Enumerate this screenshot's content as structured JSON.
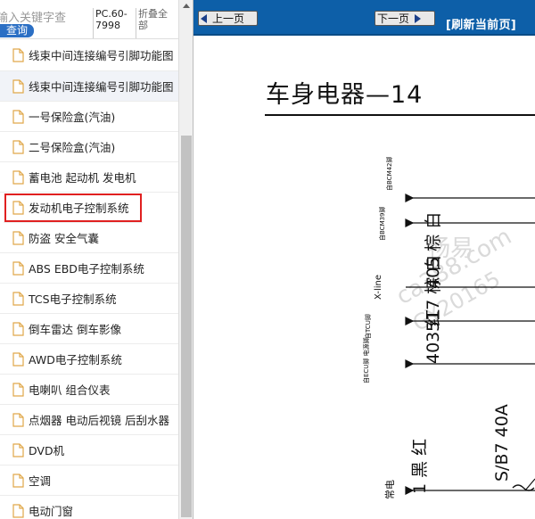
{
  "sidebar": {
    "search": {
      "placeholder": "输入关键字查"
    },
    "search_button": "查询",
    "tab_model": "PC.60-7998",
    "tab_collapse": "折叠全部",
    "items": [
      {
        "label": "线束中间连接编号引脚功能图"
      },
      {
        "label": "线束中间连接编号引脚功能图"
      },
      {
        "label": "一号保险盒(汽油)"
      },
      {
        "label": "二号保险盒(汽油)"
      },
      {
        "label": "蓄电池 起动机 发电机"
      },
      {
        "label": "发动机电子控制系统"
      },
      {
        "label": "防盗 安全气囊"
      },
      {
        "label": "ABS EBD电子控制系统"
      },
      {
        "label": "TCS电子控制系统"
      },
      {
        "label": "倒车雷达 倒车影像"
      },
      {
        "label": "AWD电子控制系统"
      },
      {
        "label": "电喇叭 组合仪表"
      },
      {
        "label": "点烟器 电动后视镜 后刮水器"
      },
      {
        "label": "DVD机"
      },
      {
        "label": "空调"
      },
      {
        "label": "电动门窗"
      }
    ],
    "icon": "document-icon"
  },
  "viewer": {
    "prev_label": "上一页",
    "next_label": "下一页",
    "refresh_label": "[刷新当前页]",
    "page_title": "车身电器—14",
    "watermark": [
      "畅易",
      "ca388.com",
      "GY20165"
    ],
    "schematic": {
      "lines": [
        "自BCM42脚",
        "自BCM39脚",
        "X-line",
        "自TCU脚",
        "自ECU脚 电源脚",
        "常电"
      ],
      "wire_codes": [
        "405 棕 白",
        "517 棕 白",
        "403 红",
        "1 黑 红"
      ],
      "fuse": "S/B7 40A"
    }
  },
  "colors": {
    "navbar": "#0d5fa8",
    "highlight": "#e02020",
    "search_button": "#2b6fc4"
  }
}
